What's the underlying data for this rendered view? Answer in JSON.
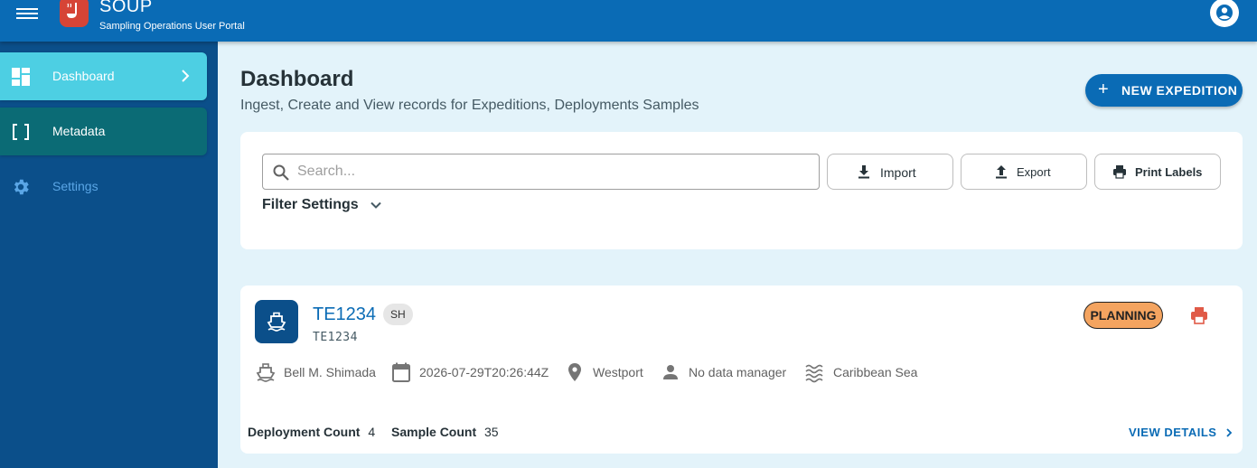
{
  "header": {
    "app_title": "SOUP",
    "app_subtitle": "Sampling Operations User Portal",
    "icons": {
      "menu": "menu-icon",
      "logo": "soup-ladle-logo",
      "user": "account-circle-icon"
    },
    "brand_color": "#0a6bb5",
    "logo_color": "#d64436"
  },
  "sidebar": {
    "items": [
      {
        "label": "Dashboard",
        "icon": "dashboard-icon",
        "active": true
      },
      {
        "label": "Metadata",
        "icon": "brackets-icon",
        "active": false
      },
      {
        "label": "Settings",
        "icon": "gear-icon",
        "active": false
      }
    ],
    "bg_color": "#0b4f8a",
    "active_color": "#4dcfe3"
  },
  "main": {
    "title": "Dashboard",
    "subtitle": "Ingest, Create and View records for Expeditions, Deployments Samples",
    "new_expedition_label": "NEW EXPEDITION"
  },
  "filter": {
    "search_placeholder": "Search...",
    "search_value": "",
    "import_label": "Import",
    "export_label": "Export",
    "print_labels_label": "Print Labels",
    "filter_settings_label": "Filter Settings"
  },
  "expedition": {
    "name": "TE1234",
    "chip": "SH",
    "code": "TE1234",
    "status": "PLANNING",
    "status_color": "#f4a460",
    "vessel": "Bell M. Shimada",
    "date": "2026-07-29T20:26:44Z",
    "port": "Westport",
    "data_manager": "No data manager",
    "region": "Caribbean Sea",
    "deployment_count_label": "Deployment Count",
    "deployment_count": "4",
    "sample_count_label": "Sample Count",
    "sample_count": "35",
    "view_details_label": "VIEW DETAILS"
  }
}
